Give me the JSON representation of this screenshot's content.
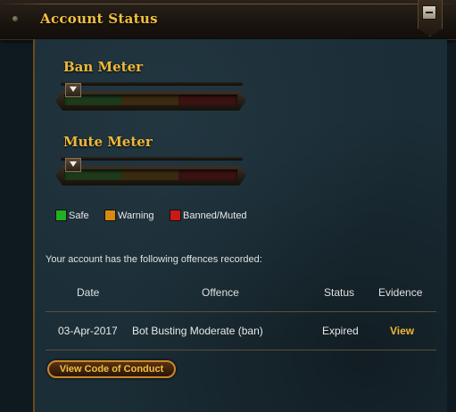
{
  "header": {
    "title": "Account Status"
  },
  "ban_meter": {
    "title": "Ban Meter",
    "level": 0.0
  },
  "mute_meter": {
    "title": "Mute Meter",
    "level": 0.0
  },
  "legend": [
    {
      "label": "Safe",
      "color": "#22b022"
    },
    {
      "label": "Warning",
      "color": "#d88a10"
    },
    {
      "label": "Banned/Muted",
      "color": "#cc1818"
    }
  ],
  "offences": {
    "intro": "Your account has the following offences recorded:",
    "columns": {
      "date": "Date",
      "offence": "Offence",
      "status": "Status",
      "evidence": "Evidence"
    },
    "rows": [
      {
        "date": "03-Apr-2017",
        "offence": "Bot Busting Moderate (ban)",
        "status": "Expired",
        "evidence": "View"
      }
    ]
  },
  "code_of_conduct_button": "View Code of Conduct"
}
